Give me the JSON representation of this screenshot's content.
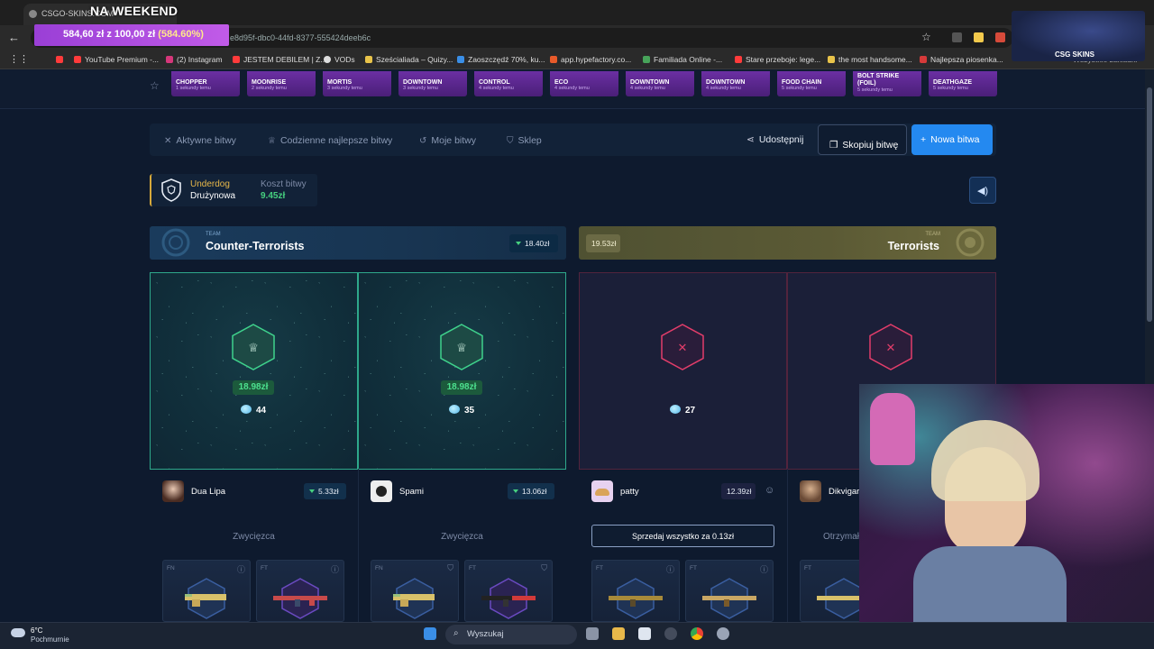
{
  "browser": {
    "tab_title": "CSGO-SKINS.COM",
    "stream_title": "NA WEEKEND",
    "url": "e8d95f-dbc0-44fd-8377-555424deeb6c",
    "donation_goal": {
      "text": "584,60 zł z 100,00 zł",
      "percent": "(584.60%)"
    },
    "bookmarks": [
      {
        "label": "YouTube Premium -...",
        "color": "#ff3b3b"
      },
      {
        "label": "(2) Instagram",
        "color": "#d6377a"
      },
      {
        "label": "JESTEM DEBILEM | Z...",
        "color": "#ff3b3b"
      },
      {
        "label": "VODs",
        "color": "#dddddd"
      },
      {
        "label": "Sześcialiada – Quizy...",
        "color": "#e8c34a"
      },
      {
        "label": "Zaoszczędź 70%, ku...",
        "color": "#3a8ee6"
      },
      {
        "label": "app.hypefactory.co...",
        "color": "#e85a2a"
      },
      {
        "label": "Familiada Online -...",
        "color": "#47a35a"
      },
      {
        "label": "Stare przeboje: lege...",
        "color": "#ff3b3b"
      },
      {
        "label": "the most handsome...",
        "color": "#e8c34a"
      },
      {
        "label": "Najlepsza piosenka...",
        "color": "#d63a3a"
      }
    ],
    "all_bookmarks": "Wszystkie zakładki"
  },
  "drops": [
    {
      "name": "CHOPPER",
      "time": "1 sekundy temu"
    },
    {
      "name": "MOONRISE",
      "time": "2 sekundy temu"
    },
    {
      "name": "MORTIS",
      "time": "3 sekundy temu"
    },
    {
      "name": "DOWNTOWN",
      "time": "3 sekundy temu"
    },
    {
      "name": "CONTROL",
      "time": "4 sekundy temu"
    },
    {
      "name": "ECO",
      "time": "4 sekundy temu"
    },
    {
      "name": "DOWNTOWN",
      "time": "4 sekundy temu"
    },
    {
      "name": "DOWNTOWN",
      "time": "4 sekundy temu"
    },
    {
      "name": "FOOD CHAIN",
      "time": "5 sekundy temu"
    },
    {
      "name": "BOLT STRIKE (FOIL)",
      "time": "5 sekundy temu"
    },
    {
      "name": "DEATHGAZE",
      "time": "5 sekundy temu"
    }
  ],
  "nav": {
    "active_battles": "Aktywne bitwy",
    "daily_best": "Codzienne najlepsze bitwy",
    "my_battles": "Moje bitwy",
    "shop": "Sklep",
    "share": "Udostępnij",
    "copy_battle": "Skopiuj bitwę",
    "new_battle": "Nowa bitwa"
  },
  "battle_info": {
    "mode": "Underdog",
    "team_mode": "Drużynowa",
    "cost_label": "Koszt bitwy",
    "cost_value": "9.45zł"
  },
  "teams": {
    "ct": {
      "label": "TEAM",
      "name": "Counter-Terrorists",
      "value": "18.40zł"
    },
    "t": {
      "label": "TEAM",
      "name": "Terrorists",
      "value": "19.53zł"
    }
  },
  "panels": [
    {
      "status": "win",
      "prize": "18.98zł",
      "gems": "44"
    },
    {
      "status": "win",
      "prize": "18.98zł",
      "gems": "35"
    },
    {
      "status": "lose",
      "gems": "27"
    },
    {
      "status": "lose"
    }
  ],
  "players": [
    {
      "name": "Dua Lipa",
      "value": "5.33zł",
      "result": "Zwycięzca"
    },
    {
      "name": "Spami",
      "value": "13.06zł",
      "result": "Zwycięzca"
    },
    {
      "name": "patty",
      "value": "12.39zł",
      "sell_label": "Sprzedaj wszystko za 0.13zł"
    },
    {
      "name": "Dikvigar",
      "result": "Otrzymał"
    }
  ],
  "items": [
    {
      "quality": "FN"
    },
    {
      "quality": "FT"
    },
    {
      "quality": "FN"
    },
    {
      "quality": "FT"
    },
    {
      "quality": "FT"
    },
    {
      "quality": "FT"
    },
    {
      "quality": "FT"
    }
  ],
  "overlay": {
    "logo_text": "CSG SKINS"
  },
  "taskbar": {
    "temperature": "6°C",
    "weather": "Pochmurnie",
    "search": "Wyszukaj"
  }
}
